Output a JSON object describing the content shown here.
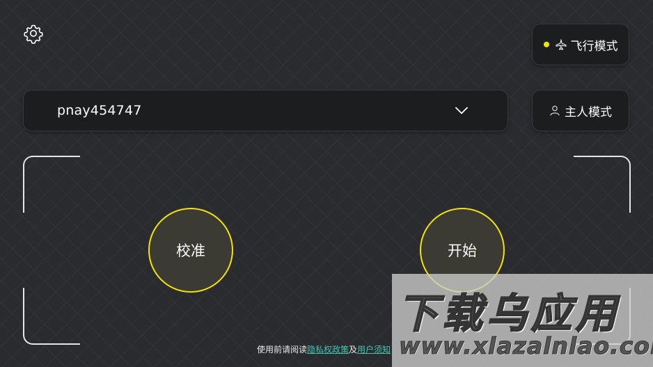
{
  "header": {
    "settings_icon": "gear-icon"
  },
  "mode_buttons": {
    "flight_label": "飞行模式",
    "flight_icon": "airplane-icon",
    "host_label": "主人模式",
    "host_icon": "person-icon",
    "active_indicator_color": "#f5e400"
  },
  "device_select": {
    "value": "pnay454747",
    "icon": "chevron-down-icon"
  },
  "actions": {
    "calibrate_label": "校准",
    "start_label": "开始",
    "accent_color": "#f5e400"
  },
  "footer": {
    "prefix": "使用前请阅读",
    "privacy_link": "隐私权政策",
    "joiner": "及",
    "terms_link_visible": "用户须知"
  },
  "watermark": {
    "title": "下载乌应用",
    "url": "www.xlazalnlao.com"
  }
}
